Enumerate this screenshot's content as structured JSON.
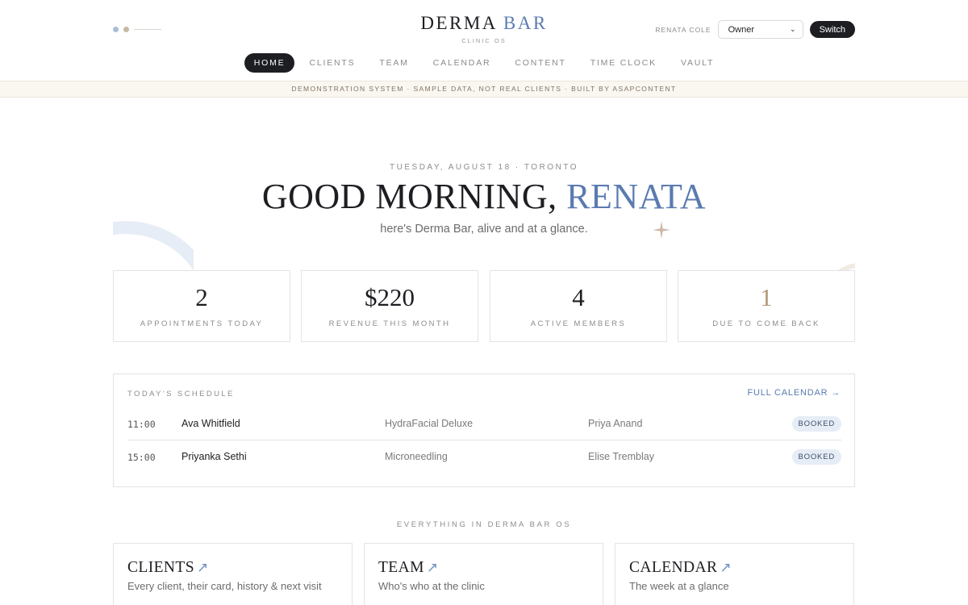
{
  "header": {
    "brand_main": "DERMA",
    "brand_accent": "BAR",
    "brand_sub": "CLINIC OS",
    "user_name": "RENATA COLE",
    "role_value": "Owner",
    "switch_label": "Switch"
  },
  "nav": {
    "items": [
      {
        "label": "HOME",
        "active": true
      },
      {
        "label": "CLIENTS"
      },
      {
        "label": "TEAM"
      },
      {
        "label": "CALENDAR"
      },
      {
        "label": "CONTENT"
      },
      {
        "label": "TIME CLOCK"
      },
      {
        "label": "VAULT"
      }
    ]
  },
  "banner": "DEMONSTRATION SYSTEM · SAMPLE DATA, NOT REAL CLIENTS · BUILT BY ASAPCONTENT",
  "hero": {
    "date_line": "TUESDAY, AUGUST 18 · TORONTO",
    "greeting": "GOOD MORNING,",
    "name": "RENATA",
    "subtitle": "here's Derma Bar, alive and at a glance."
  },
  "stats": [
    {
      "value": "2",
      "label": "APPOINTMENTS TODAY"
    },
    {
      "value": "$220",
      "label": "REVENUE THIS MONTH"
    },
    {
      "value": "4",
      "label": "ACTIVE MEMBERS"
    },
    {
      "value": "1",
      "label": "DUE TO COME BACK"
    }
  ],
  "schedule": {
    "title": "TODAY'S SCHEDULE",
    "link": "FULL CALENDAR →",
    "rows": [
      {
        "time": "11:00",
        "client": "Ava Whitfield",
        "service": "HydraFacial Deluxe",
        "staff": "Priya Anand",
        "status": "BOOKED"
      },
      {
        "time": "15:00",
        "client": "Priyanka Sethi",
        "service": "Microneedling",
        "staff": "Elise Tremblay",
        "status": "BOOKED"
      }
    ]
  },
  "modules": {
    "title": "EVERYTHING IN DERMA BAR OS",
    "cards": [
      {
        "title": "CLIENTS",
        "desc": "Every client, their card, history & next visit"
      },
      {
        "title": "TEAM",
        "desc": "Who's who at the clinic"
      },
      {
        "title": "CALENDAR",
        "desc": "The week at a glance"
      }
    ]
  },
  "colors": {
    "accent": "#5a7bb0",
    "dark": "#1d1e22",
    "warm": "#b09676",
    "badge_bg": "#e6edf6"
  }
}
